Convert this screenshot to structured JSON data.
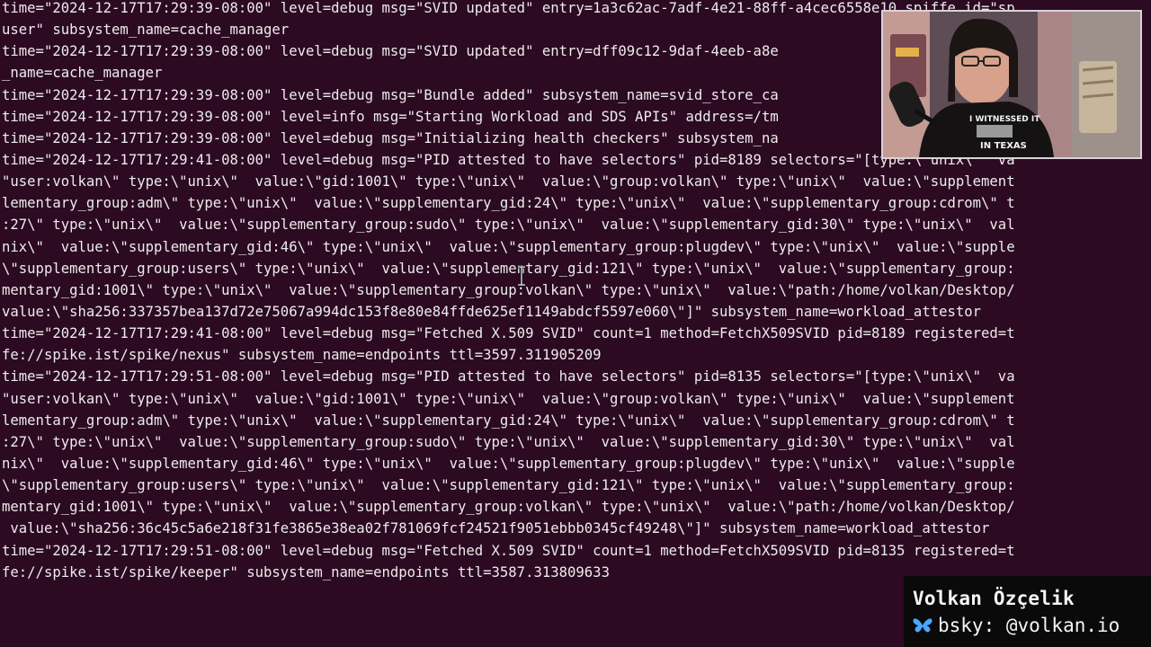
{
  "terminal": {
    "lines": [
      "time=\"2024-12-17T17:29:39-08:00\" level=debug msg=\"SVID updated\" entry=1a3c62ac-7adf-4e21-88ff-a4cec6558e10 spiffe_id=\"sp",
      "user\" subsystem_name=cache_manager",
      "time=\"2024-12-17T17:29:39-08:00\" level=debug msg=\"SVID updated\" entry=dff09c12-9daf-4eeb-a8e",
      "_name=cache_manager",
      "time=\"2024-12-17T17:29:39-08:00\" level=debug msg=\"Bundle added\" subsystem_name=svid_store_ca",
      "time=\"2024-12-17T17:29:39-08:00\" level=info msg=\"Starting Workload and SDS APIs\" address=/tm",
      "time=\"2024-12-17T17:29:39-08:00\" level=debug msg=\"Initializing health checkers\" subsystem_na",
      "time=\"2024-12-17T17:29:41-08:00\" level=debug msg=\"PID attested to have selectors\" pid=8189 selectors=\"[type:\\\"unix\\\"  va",
      "\"user:volkan\\\" type:\\\"unix\\\"  value:\\\"gid:1001\\\" type:\\\"unix\\\"  value:\\\"group:volkan\\\" type:\\\"unix\\\"  value:\\\"supplement",
      "lementary_group:adm\\\" type:\\\"unix\\\"  value:\\\"supplementary_gid:24\\\" type:\\\"unix\\\"  value:\\\"supplementary_group:cdrom\\\" t",
      ":27\\\" type:\\\"unix\\\"  value:\\\"supplementary_group:sudo\\\" type:\\\"unix\\\"  value:\\\"supplementary_gid:30\\\" type:\\\"unix\\\"  val",
      "nix\\\"  value:\\\"supplementary_gid:46\\\" type:\\\"unix\\\"  value:\\\"supplementary_group:plugdev\\\" type:\\\"unix\\\"  value:\\\"supple",
      "\\\"supplementary_group:users\\\" type:\\\"unix\\\"  value:\\\"supplementary_gid:121\\\" type:\\\"unix\\\"  value:\\\"supplementary_group:",
      "mentary_gid:1001\\\" type:\\\"unix\\\"  value:\\\"supplementary_group:volkan\\\" type:\\\"unix\\\"  value:\\\"path:/home/volkan/Desktop/",
      "value:\\\"sha256:337357bea137d72e75067a994dc153f8e80e84ffde625ef1149abdcf5597e060\\\"]\" subsystem_name=workload_attestor",
      "time=\"2024-12-17T17:29:41-08:00\" level=debug msg=\"Fetched X.509 SVID\" count=1 method=FetchX509SVID pid=8189 registered=t",
      "fe://spike.ist/spike/nexus\" subsystem_name=endpoints ttl=3597.311905209",
      "time=\"2024-12-17T17:29:51-08:00\" level=debug msg=\"PID attested to have selectors\" pid=8135 selectors=\"[type:\\\"unix\\\"  va",
      "\"user:volkan\\\" type:\\\"unix\\\"  value:\\\"gid:1001\\\" type:\\\"unix\\\"  value:\\\"group:volkan\\\" type:\\\"unix\\\"  value:\\\"supplement",
      "lementary_group:adm\\\" type:\\\"unix\\\"  value:\\\"supplementary_gid:24\\\" type:\\\"unix\\\"  value:\\\"supplementary_group:cdrom\\\" t",
      ":27\\\" type:\\\"unix\\\"  value:\\\"supplementary_group:sudo\\\" type:\\\"unix\\\"  value:\\\"supplementary_gid:30\\\" type:\\\"unix\\\"  val",
      "nix\\\"  value:\\\"supplementary_gid:46\\\" type:\\\"unix\\\"  value:\\\"supplementary_group:plugdev\\\" type:\\\"unix\\\"  value:\\\"supple",
      "\\\"supplementary_group:users\\\" type:\\\"unix\\\"  value:\\\"supplementary_gid:121\\\" type:\\\"unix\\\"  value:\\\"supplementary_group:",
      "mentary_gid:1001\\\" type:\\\"unix\\\"  value:\\\"supplementary_group:volkan\\\" type:\\\"unix\\\"  value:\\\"path:/home/volkan/Desktop/",
      " value:\\\"sha256:36c45c5a6e218f31fe3865e38ea02f781069fcf24521f9051ebbb0345cf49248\\\"]\" subsystem_name=workload_attestor",
      "time=\"2024-12-17T17:29:51-08:00\" level=debug msg=\"Fetched X.509 SVID\" count=1 method=FetchX509SVID pid=8135 registered=t",
      "fe://spike.ist/spike/keeper\" subsystem_name=endpoints ttl=3587.313809633"
    ]
  },
  "webcam": {
    "shirt_text": [
      "I WITNESSED IT",
      "IN TEXAS"
    ]
  },
  "caption": {
    "name": "Volkan Özçelik",
    "handle": "bsky: @volkan.io",
    "icon": "butterfly-icon"
  },
  "colors": {
    "terminal_background": "#2c0a22",
    "terminal_text": "#ececec",
    "caption_background": "#0a0a0a",
    "butterfly": "#4aa8ff"
  }
}
